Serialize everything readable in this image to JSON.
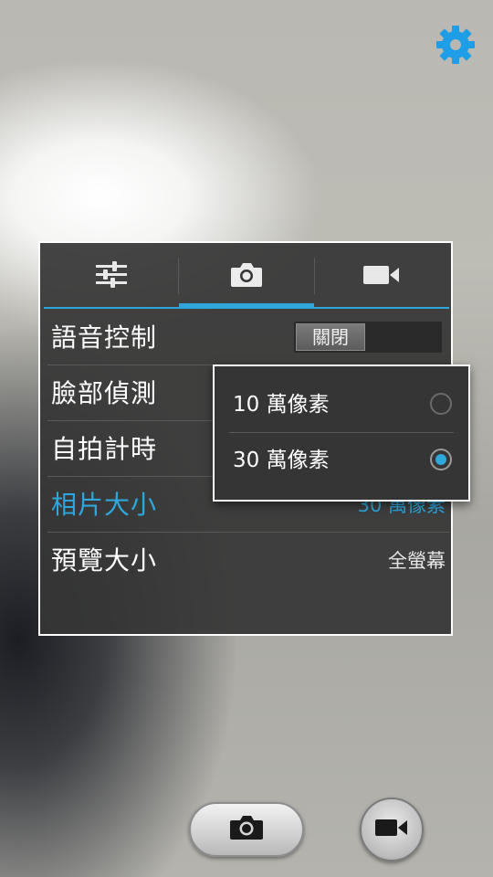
{
  "panel": {
    "tabs": [
      {
        "name": "general-settings",
        "icon": "sliders-icon"
      },
      {
        "name": "camera-settings",
        "icon": "camera-icon",
        "active": true
      },
      {
        "name": "video-settings",
        "icon": "video-camera-icon"
      }
    ],
    "rows": [
      {
        "label": "語音控制",
        "value": "關閉",
        "type": "toggle"
      },
      {
        "label": "臉部偵測",
        "value": ""
      },
      {
        "label": "自拍計時",
        "value": ""
      },
      {
        "label": "相片大小",
        "value": "30 萬像素",
        "active": true
      },
      {
        "label": "預覽大小",
        "value": "全螢幕"
      }
    ]
  },
  "popup": {
    "options": [
      {
        "label": "10 萬像素",
        "selected": false
      },
      {
        "label": "30 萬像素",
        "selected": true
      }
    ]
  },
  "controls": {
    "settings_icon": "gear-icon",
    "shutter_icon": "camera-icon",
    "video_icon": "video-camera-icon"
  },
  "colors": {
    "accent": "#2ea7dd",
    "panel_bg": "#363636"
  }
}
